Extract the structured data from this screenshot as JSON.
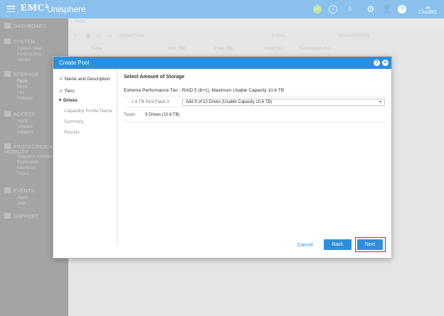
{
  "header": {
    "brand": "EMC²",
    "product": "Unisphere",
    "icons": [
      "menu-icon",
      "check-circle-icon",
      "info-icon",
      "alert-icon",
      "gear-icon",
      "user-icon",
      "help-icon",
      "cloudiq-icon"
    ],
    "help_glyph": "?",
    "cloud_label": "CloudIQ"
  },
  "sidebar": {
    "sections": [
      {
        "label": "DASHBOARD",
        "items": []
      },
      {
        "label": "SYSTEM",
        "items": [
          "System View",
          "Performance",
          "Service"
        ]
      },
      {
        "label": "STORAGE",
        "items": [
          "Pools",
          "Block",
          "File",
          "VMware"
        ]
      },
      {
        "label": "ACCESS",
        "items": [
          "Hosts",
          "VMware",
          "Initiators"
        ]
      },
      {
        "label": "PROTECTION & MOBILITY",
        "items": [
          "Snapshot Schedule",
          "Replication",
          "Interfaces",
          "Import"
        ]
      },
      {
        "label": "EVENTS",
        "items": [
          "Alerts",
          "Jobs"
        ]
      },
      {
        "label": "SUPPORT",
        "items": []
      }
    ]
  },
  "main": {
    "tab": "Pools",
    "toolbar": {
      "expand": "Expand Pool",
      "count": "0 items"
    },
    "columns": [
      "Name",
      "Size (TB)",
      "Free (TB)",
      "Used (%)",
      "Subscription (%)"
    ],
    "details_title": "RANGERSPOOL"
  },
  "dialog": {
    "title": "Create Pool",
    "steps": [
      {
        "label": "Name and Description",
        "state": "done"
      },
      {
        "label": "Tiers",
        "state": "done"
      },
      {
        "label": "Drives",
        "state": "current"
      },
      {
        "label": "Capability Profile Name",
        "state": "pending"
      },
      {
        "label": "Summary",
        "state": "pending"
      },
      {
        "label": "Results",
        "state": "pending"
      }
    ],
    "section_title": "Select Amount of Storage",
    "tier_label": "Extreme Performance Tier - RAID 5 (8+1), Maximum Usable Capacity 10.6 TB",
    "drive_label": "1.6 TB SAS Flash 3",
    "drive_select": "Add 9 of 10 Drives (Usable Capacity 10.6 TB)",
    "totals_label": "Totals:",
    "totals_value": "9 Drives (10.6 TB)",
    "cancel": "Cancel",
    "back": "Back",
    "next": "Next"
  }
}
